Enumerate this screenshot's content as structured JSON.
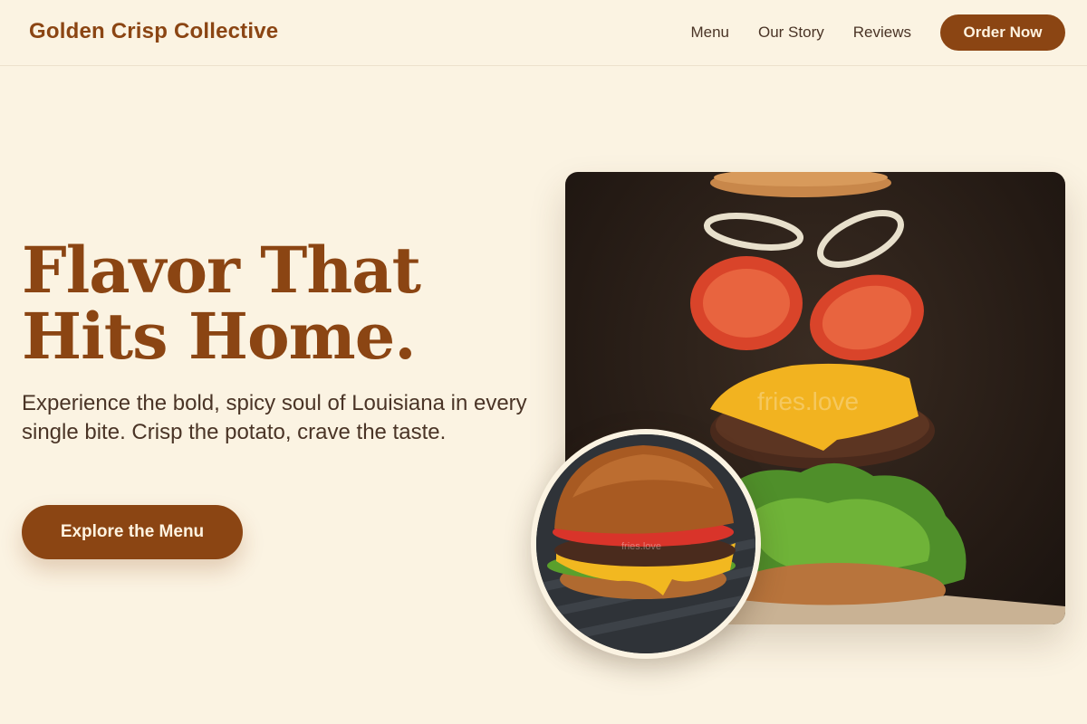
{
  "header": {
    "brand": "Golden Crisp Collective",
    "nav": [
      "Menu",
      "Our Story",
      "Reviews"
    ],
    "cta": "Order Now"
  },
  "hero": {
    "title": "Flavor That Hits Home.",
    "subtitle": "Experience the bold, spicy soul of Louisiana in every single bite. Crisp the potato, crave the taste.",
    "button": "Explore the Menu"
  },
  "images": {
    "main_watermark": "fries.love",
    "inset_watermark": "fries.love"
  },
  "colors": {
    "background": "#fbf3e2",
    "brand": "#8b4513",
    "text": "#4a3426"
  }
}
